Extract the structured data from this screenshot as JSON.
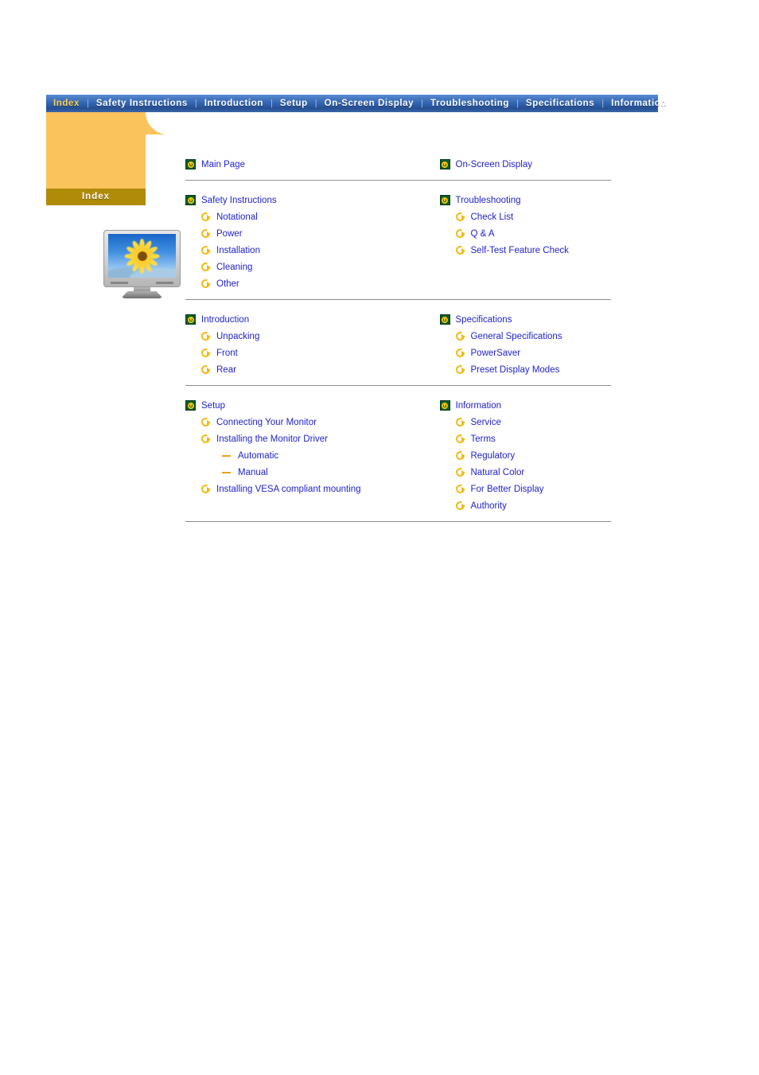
{
  "nav": {
    "separator": "|",
    "items": [
      {
        "label": "Index",
        "active": true
      },
      {
        "label": "Safety Instructions",
        "active": false
      },
      {
        "label": "Introduction",
        "active": false
      },
      {
        "label": "Setup",
        "active": false
      },
      {
        "label": "On-Screen Display",
        "active": false
      },
      {
        "label": "Troubleshooting",
        "active": false
      },
      {
        "label": "Specifications",
        "active": false
      },
      {
        "label": "Information",
        "active": false
      }
    ]
  },
  "sidebar": {
    "tab_label": "Index",
    "image_alt": "lcd-monitor-with-sunflower-wallpaper",
    "panel_color": "#fbc35c",
    "tab_color": "#b08a09"
  },
  "colors": {
    "link": "#2222cc",
    "nav_active": "#ffd24a",
    "nav_text": "#ffffff",
    "rule": "#8d8d8d",
    "icon_green": "#0d5c2b",
    "icon_yellow": "#f2c40d",
    "icon_dash": "#e8a21a"
  },
  "content": {
    "blocks": [
      {
        "left": {
          "title": "Main Page",
          "children": []
        },
        "right": {
          "title": "On-Screen Display",
          "children": []
        }
      },
      {
        "left": {
          "title": "Safety Instructions",
          "children": [
            {
              "label": "Notational",
              "level": 2
            },
            {
              "label": "Power",
              "level": 2
            },
            {
              "label": "Installation",
              "level": 2
            },
            {
              "label": "Cleaning",
              "level": 2
            },
            {
              "label": "Other",
              "level": 2
            }
          ]
        },
        "right": {
          "title": "Troubleshooting",
          "children": [
            {
              "label": "Check List",
              "level": 2
            },
            {
              "label": "Q & A",
              "level": 2
            },
            {
              "label": "Self-Test Feature Check",
              "level": 2
            }
          ]
        }
      },
      {
        "left": {
          "title": "Introduction",
          "children": [
            {
              "label": "Unpacking",
              "level": 2
            },
            {
              "label": "Front",
              "level": 2
            },
            {
              "label": "Rear",
              "level": 2
            }
          ]
        },
        "right": {
          "title": "Specifications",
          "children": [
            {
              "label": "General Specifications",
              "level": 2
            },
            {
              "label": "PowerSaver",
              "level": 2
            },
            {
              "label": "Preset Display Modes",
              "level": 2
            }
          ]
        }
      },
      {
        "left": {
          "title": "Setup",
          "children": [
            {
              "label": "Connecting Your Monitor",
              "level": 2
            },
            {
              "label": "Installing the Monitor Driver",
              "level": 2
            },
            {
              "label": "Automatic",
              "level": 3
            },
            {
              "label": "Manual",
              "level": 3
            },
            {
              "label": "Installing VESA compliant mounting",
              "level": 2
            }
          ]
        },
        "right": {
          "title": "Information",
          "children": [
            {
              "label": "Service",
              "level": 2
            },
            {
              "label": "Terms",
              "level": 2
            },
            {
              "label": "Regulatory",
              "level": 2
            },
            {
              "label": "Natural Color",
              "level": 2
            },
            {
              "label": "For Better Display",
              "level": 2
            },
            {
              "label": "Authority",
              "level": 2
            }
          ]
        }
      }
    ]
  }
}
